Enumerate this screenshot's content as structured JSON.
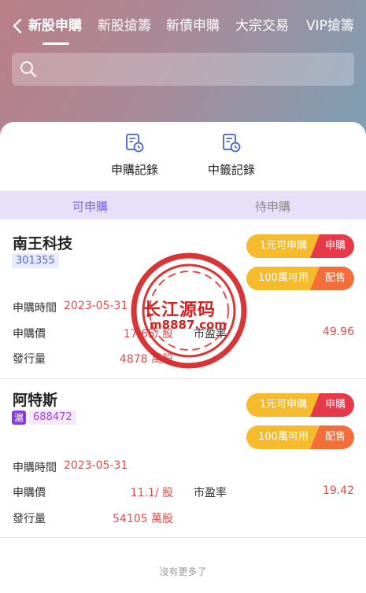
{
  "nav": {
    "tabs": [
      {
        "label": "新股申購"
      },
      {
        "label": "新股搶籌"
      },
      {
        "label": "新債申購"
      },
      {
        "label": "大宗交易"
      },
      {
        "label": "VIP搶籌"
      }
    ],
    "active_tab": "新股申購"
  },
  "search": {
    "placeholder": ""
  },
  "quick_links": [
    {
      "label": "申購記錄",
      "icon": "record-icon"
    },
    {
      "label": "中籤記錄",
      "icon": "record-icon"
    }
  ],
  "sub_tabs": [
    {
      "label": "可申購"
    },
    {
      "label": "待申購"
    }
  ],
  "stocks": [
    {
      "name": "南王科技",
      "code": "301355",
      "market_badge": "",
      "buy_label": "1元可申購",
      "buy_action": "申購",
      "alloc_label": "100萬可用",
      "alloc_action": "配售",
      "date_label": "申購時間",
      "date": "2023-05-31",
      "price_label": "申購價",
      "price": "17.65/ 股",
      "pe_label": "市盈率",
      "pe": "49.96",
      "issue_label": "發行量",
      "issue": "4878 萬股"
    },
    {
      "name": "阿特斯",
      "code": "688472",
      "market_badge": "滬",
      "buy_label": "1元可申購",
      "buy_action": "申購",
      "alloc_label": "100萬可用",
      "alloc_action": "配售",
      "date_label": "申購時間",
      "date": "2023-05-31",
      "price_label": "申購價",
      "price": "11.1/ 股",
      "pe_label": "市盈率",
      "pe": "19.42",
      "issue_label": "發行量",
      "issue": "54105 萬股"
    }
  ],
  "footer": {
    "text": "沒有更多了"
  },
  "watermark": {
    "title": "长江源码",
    "url": "m8887.com"
  },
  "colors": {
    "accent": "#7b63e6",
    "value_red": "#e24a4a",
    "pill_yellow": "#f6bb2c",
    "pill_red": "#e8394a",
    "pill_orange": "#f46e3a"
  }
}
